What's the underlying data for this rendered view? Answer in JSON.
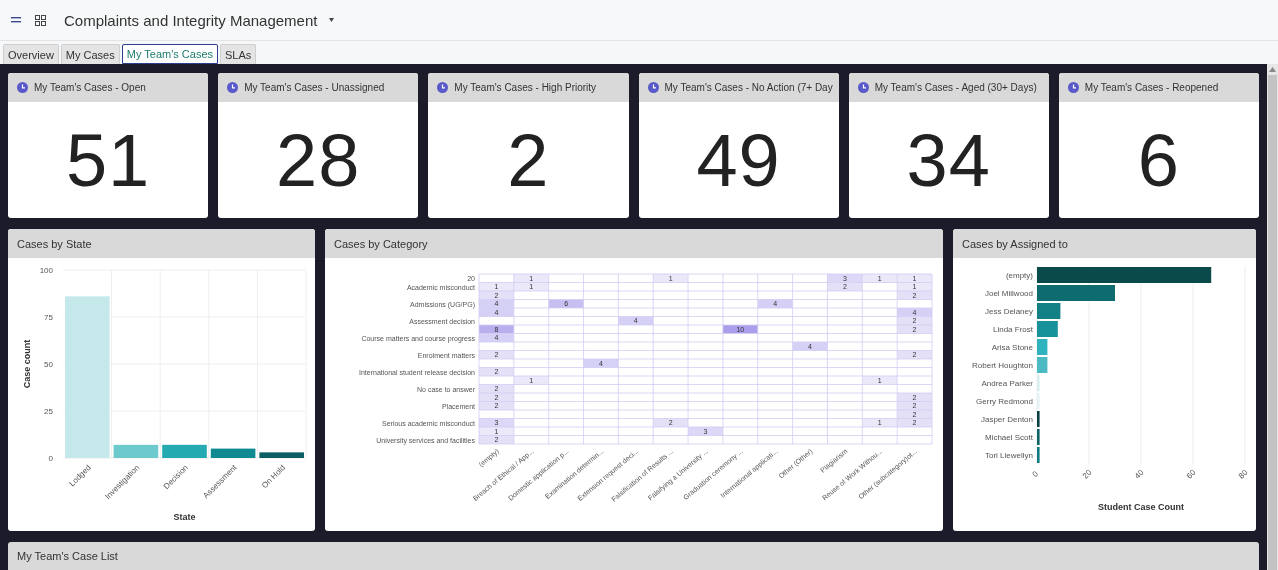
{
  "header": {
    "title": "Complaints and Integrity Management"
  },
  "tabs": [
    {
      "label": "Overview",
      "selected": false
    },
    {
      "label": "My Cases",
      "selected": false
    },
    {
      "label": "My Team's Cases",
      "selected": true
    },
    {
      "label": "SLAs",
      "selected": false
    }
  ],
  "kpis": [
    {
      "title": "My Team's Cases - Open",
      "value": "51"
    },
    {
      "title": "My Team's Cases - Unassigned",
      "value": "28"
    },
    {
      "title": "My Team's Cases - High Priority",
      "value": "2"
    },
    {
      "title": "My Team's Cases - No Action (7+ Day",
      "value": "49"
    },
    {
      "title": "My Team's Cases - Aged (30+ Days)",
      "value": "34"
    },
    {
      "title": "My Team's Cases - Reopened",
      "value": "6"
    }
  ],
  "cases_by_state": {
    "title": "Cases by State",
    "chart_data": {
      "type": "bar",
      "xlabel": "State",
      "ylabel": "Case count",
      "categories": [
        "Lodged",
        "Investigation",
        "Decision",
        "Assessment",
        "On Hold"
      ],
      "values": [
        86,
        7,
        7,
        5,
        3
      ],
      "grid": true,
      "ylim": [
        0,
        100
      ],
      "yticks": [
        0,
        25,
        50,
        75,
        100
      ]
    }
  },
  "cases_by_category": {
    "title": "Cases by Category",
    "rows": [
      {
        "label": "20",
        "cells": [
          null,
          "1",
          null,
          null,
          null,
          "1",
          null,
          null,
          null,
          null,
          "3",
          "1",
          "1"
        ]
      },
      {
        "label": "Academic misconduct",
        "cells": [
          "1",
          "1",
          null,
          null,
          null,
          null,
          null,
          null,
          null,
          null,
          "2",
          null,
          "1"
        ]
      },
      {
        "cells": [
          "2",
          null,
          null,
          null,
          null,
          null,
          null,
          null,
          null,
          null,
          null,
          null,
          "2"
        ]
      },
      {
        "label": "Admissions (UG/PG)",
        "cells": [
          "4",
          null,
          "6",
          null,
          null,
          null,
          null,
          null,
          "4",
          null,
          null,
          null,
          null
        ]
      },
      {
        "cells": [
          "4",
          null,
          null,
          null,
          null,
          null,
          null,
          null,
          null,
          null,
          null,
          null,
          "4"
        ]
      },
      {
        "label": "Assessment decision",
        "cells": [
          null,
          null,
          null,
          null,
          "4",
          null,
          null,
          null,
          null,
          null,
          null,
          null,
          "2"
        ]
      },
      {
        "cells": [
          "8",
          null,
          null,
          null,
          null,
          null,
          null,
          "10",
          null,
          null,
          null,
          null,
          "2"
        ]
      },
      {
        "label": "Course matters and course progress",
        "cells": [
          "4",
          null,
          null,
          null,
          null,
          null,
          null,
          null,
          null,
          null,
          null,
          null,
          null
        ]
      },
      {
        "cells": [
          null,
          null,
          null,
          null,
          null,
          null,
          null,
          null,
          null,
          "4",
          null,
          null,
          null
        ]
      },
      {
        "label": "Enrolment matters",
        "cells": [
          "2",
          null,
          null,
          null,
          null,
          null,
          null,
          null,
          null,
          null,
          null,
          null,
          "2"
        ]
      },
      {
        "cells": [
          null,
          null,
          null,
          "4",
          null,
          null,
          null,
          null,
          null,
          null,
          null,
          null,
          null
        ]
      },
      {
        "label": "International student release decision",
        "cells": [
          "2",
          null,
          null,
          null,
          null,
          null,
          null,
          null,
          null,
          null,
          null,
          null,
          null
        ]
      },
      {
        "cells": [
          null,
          "1",
          null,
          null,
          null,
          null,
          null,
          null,
          null,
          null,
          null,
          "1",
          null
        ]
      },
      {
        "label": "No case to answer",
        "cells": [
          "2",
          null,
          null,
          null,
          null,
          null,
          null,
          null,
          null,
          null,
          null,
          null,
          null
        ]
      },
      {
        "cells": [
          "2",
          null,
          null,
          null,
          null,
          null,
          null,
          null,
          null,
          null,
          null,
          null,
          "2"
        ]
      },
      {
        "label": "Placement",
        "cells": [
          "2",
          null,
          null,
          null,
          null,
          null,
          null,
          null,
          null,
          null,
          null,
          null,
          "2"
        ]
      },
      {
        "cells": [
          null,
          null,
          null,
          null,
          null,
          null,
          null,
          null,
          null,
          null,
          null,
          null,
          "2"
        ]
      },
      {
        "label": "Serious academic misconduct",
        "cells": [
          "3",
          null,
          null,
          null,
          null,
          "2",
          null,
          null,
          null,
          null,
          null,
          "1",
          "2"
        ]
      },
      {
        "cells": [
          "1",
          null,
          null,
          null,
          null,
          null,
          "3",
          null,
          null,
          null,
          null,
          null,
          null
        ]
      },
      {
        "label": "University services and facilities",
        "cells": [
          "2",
          null,
          null,
          null,
          null,
          null,
          null,
          null,
          null,
          null,
          null,
          null,
          null
        ]
      }
    ],
    "x_axis_labels": [
      "(empty)",
      "Breach of Ethical / App...",
      "Domestic application p...",
      "Examination determin...",
      "Extension request deci...",
      "Falsification of Results ...",
      "Falsifying a University ...",
      "Graduation ceremony ...",
      "International applicati...",
      "Other (Other)",
      "Plagiarism",
      "Reuse of Work Withou...",
      "Other (subcategory)ot..."
    ]
  },
  "cases_by_assigned": {
    "title": "Cases by Assigned to",
    "chart_data": {
      "type": "bar",
      "orientation": "horizontal",
      "xlabel": "Student Case Count",
      "categories": [
        "(empty)",
        "Joel Millwood",
        "Jess Delaney",
        "Linda Frost",
        "Arisa Stone",
        "Robert Houghton",
        "Andrea Parker",
        "Gerry Redmond",
        "Jasper Denton",
        "Michael Scott",
        "Tori Llewellyn"
      ],
      "values": [
        67,
        30,
        9,
        8,
        4,
        4,
        1,
        1,
        1,
        1,
        1
      ],
      "grid": true,
      "xlim": [
        0,
        80
      ],
      "xticks": [
        0,
        20,
        40,
        60,
        80
      ]
    }
  },
  "case_list": {
    "title": "My Team's Case List"
  }
}
